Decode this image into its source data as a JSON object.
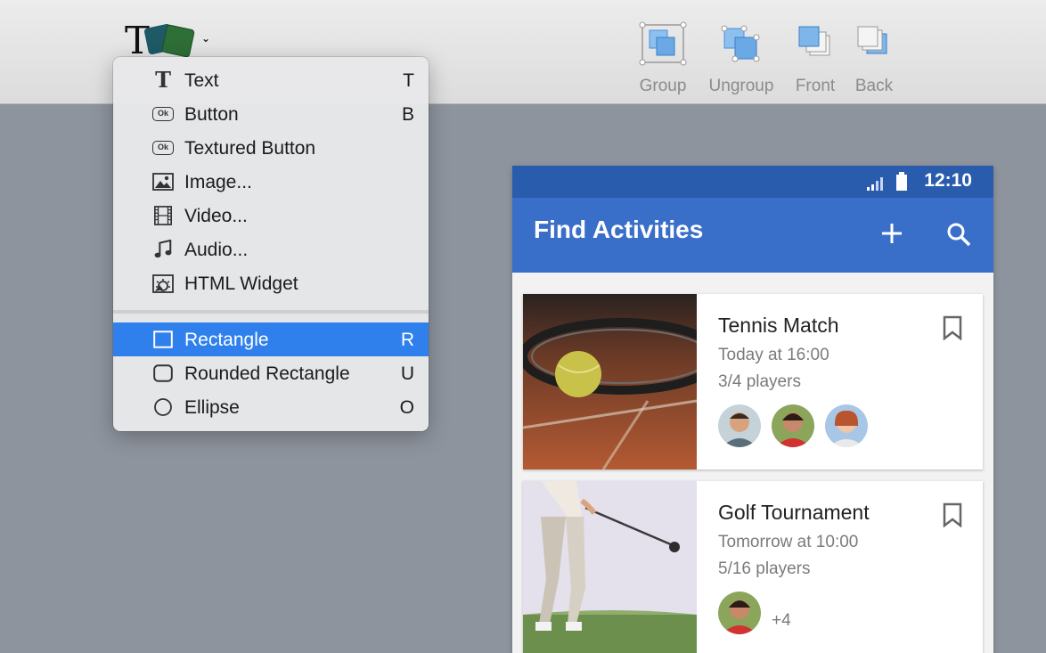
{
  "toolbar": {
    "insert_icon": "text-shape-insert-icon",
    "group_label": "Group",
    "ungroup_label": "Ungroup",
    "front_label": "Front",
    "back_label": "Back"
  },
  "menu": {
    "items": [
      {
        "icon": "text-icon",
        "label": "Text",
        "key": "T"
      },
      {
        "icon": "button-icon",
        "label": "Button",
        "key": "B"
      },
      {
        "icon": "textured-button-icon",
        "label": "Textured Button",
        "key": ""
      },
      {
        "icon": "image-icon",
        "label": "Image...",
        "key": ""
      },
      {
        "icon": "video-icon",
        "label": "Video...",
        "key": ""
      },
      {
        "icon": "audio-icon",
        "label": "Audio...",
        "key": ""
      },
      {
        "icon": "html-widget-icon",
        "label": "HTML Widget",
        "key": ""
      },
      {
        "icon": "rectangle-icon",
        "label": "Rectangle",
        "key": "R",
        "selected": true
      },
      {
        "icon": "rounded-rectangle-icon",
        "label": "Rounded Rectangle",
        "key": "U"
      },
      {
        "icon": "ellipse-icon",
        "label": "Ellipse",
        "key": "O"
      }
    ],
    "button_glyph": "Ok"
  },
  "phone": {
    "time": "12:10",
    "title": "Find Activities",
    "cards": [
      {
        "title": "Tennis Match",
        "time": "Today at 16:00",
        "players": "3/4 players",
        "more": ""
      },
      {
        "title": "Golf Tournament",
        "time": "Tomorrow at 10:00",
        "players": "5/16 players",
        "more": "+4"
      }
    ]
  },
  "colors": {
    "selection": "#2f80ed",
    "statusbar": "#2a5cae",
    "appbar": "#3a6fc9",
    "canvas": "#8e949e"
  }
}
